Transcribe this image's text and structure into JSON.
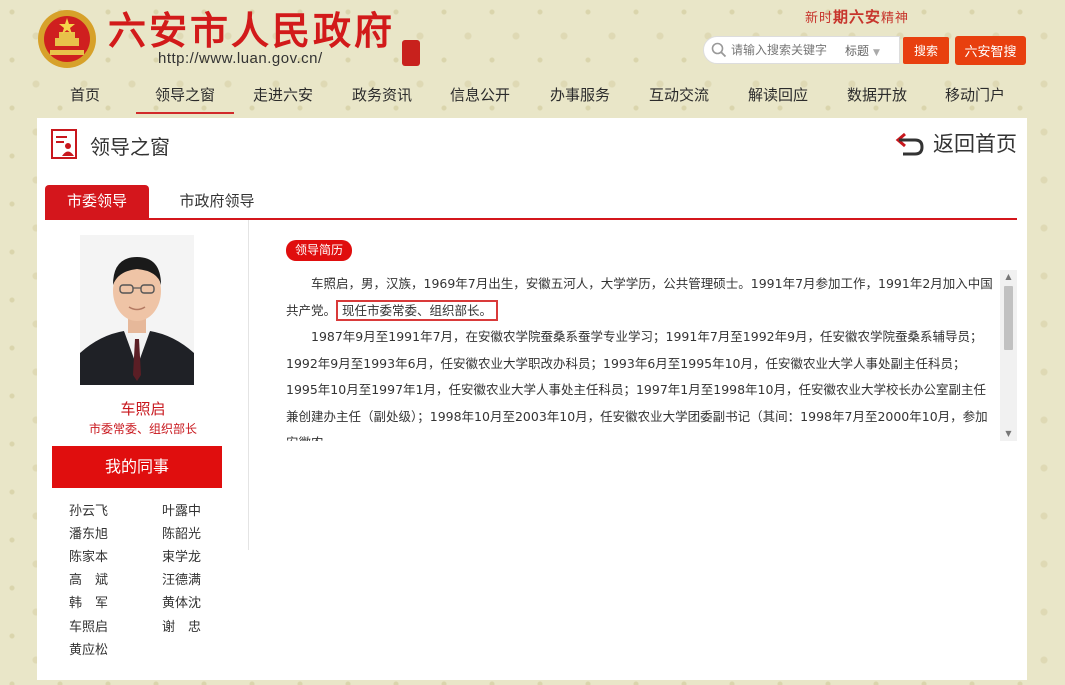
{
  "header": {
    "site_title": "六安市人民政府",
    "site_url": "http://www.luan.gov.cn/",
    "slogan_prefix": "新时",
    "slogan_main": "期六安",
    "slogan_suffix": "精神",
    "search_placeholder": "请输入搜索关键字",
    "search_type": "标题",
    "search_button": "搜索",
    "smart_search_button": "六安智搜"
  },
  "nav": [
    {
      "label": "首页"
    },
    {
      "label": "领导之窗",
      "active": true
    },
    {
      "label": "走进六安"
    },
    {
      "label": "政务资讯"
    },
    {
      "label": "信息公开"
    },
    {
      "label": "办事服务"
    },
    {
      "label": "互动交流"
    },
    {
      "label": "解读回应"
    },
    {
      "label": "数据开放"
    },
    {
      "label": "移动门户"
    }
  ],
  "panel": {
    "title": "领导之窗",
    "back_home": "返回首页",
    "tabs": [
      {
        "label": "市委领导",
        "active": true
      },
      {
        "label": "市政府领导"
      }
    ]
  },
  "leader": {
    "name": "车照启",
    "title": "市委常委、组织部长"
  },
  "colleagues": {
    "heading": "我的同事",
    "names": [
      "孙云飞",
      "叶露中",
      "潘东旭",
      "陈韶光",
      "陈家本",
      "束学龙",
      "高　斌",
      "汪德满",
      "韩　军",
      "黄体沈",
      "车照启",
      "谢　忠",
      "黄应松"
    ]
  },
  "resume": {
    "badge": "领导简历",
    "para1_a": "车照启，男，汉族，1969年7月出生，安徽五河人，大学学历，公共管理硕士。1991年7月参加工作，1991年2月加入中国共产党。",
    "para1_highlight": "现任市委常委、组织部长。",
    "para2": "1987年9月至1991年7月，在安徽农学院蚕桑系蚕学专业学习；1991年7月至1992年9月，任安徽农学院蚕桑系辅导员；1992年9月至1993年6月，任安徽农业大学职改办科员；1993年6月至1995年10月，任安徽农业大学人事处副主任科员；1995年10月至1997年1月，任安徽农业大学人事处主任科员；1997年1月至1998年10月，任安徽农业大学校长办公室副主任兼创建办主任（副处级）；1998年10月至2003年10月，任安徽农业大学团委副书记（其间：1998年7月至2000年10月，参加安徽农"
  },
  "colors": {
    "brand_red": "#d21a1a",
    "tab_red": "#d4161c",
    "button_orange": "#e8400f",
    "page_bg": "#e9e6c8"
  }
}
